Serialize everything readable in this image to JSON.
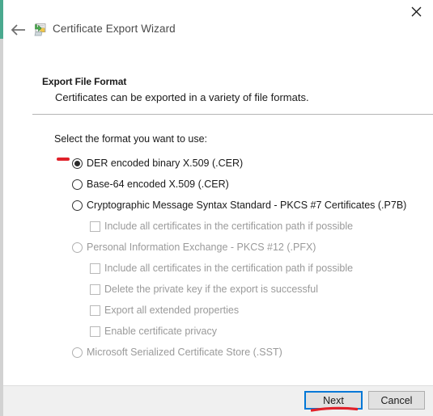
{
  "window": {
    "title": "Certificate Export Wizard",
    "back_icon": "back-arrow-icon",
    "close_icon": "close-icon",
    "app_icon": "certificate-export-icon",
    "accent_color": "#4aa98f"
  },
  "header": {
    "title": "Export File Format",
    "subtitle": "Certificates can be exported in a variety of file formats."
  },
  "body": {
    "prompt": "Select the format you want to use:",
    "options": [
      {
        "type": "radio",
        "label": "DER encoded binary X.509 (.CER)",
        "checked": true,
        "enabled": true,
        "indent": "radio"
      },
      {
        "type": "radio",
        "label": "Base-64 encoded X.509 (.CER)",
        "checked": false,
        "enabled": true,
        "indent": "radio"
      },
      {
        "type": "radio",
        "label": "Cryptographic Message Syntax Standard - PKCS #7 Certificates (.P7B)",
        "checked": false,
        "enabled": true,
        "indent": "radio"
      },
      {
        "type": "checkbox",
        "label": "Include all certificates in the certification path if possible",
        "checked": false,
        "enabled": false,
        "indent": "check"
      },
      {
        "type": "radio",
        "label": "Personal Information Exchange - PKCS #12 (.PFX)",
        "checked": false,
        "enabled": false,
        "indent": "radio"
      },
      {
        "type": "checkbox",
        "label": "Include all certificates in the certification path if possible",
        "checked": false,
        "enabled": false,
        "indent": "check"
      },
      {
        "type": "checkbox",
        "label": "Delete the private key if the export is successful",
        "checked": false,
        "enabled": false,
        "indent": "check"
      },
      {
        "type": "checkbox",
        "label": "Export all extended properties",
        "checked": false,
        "enabled": false,
        "indent": "check"
      },
      {
        "type": "checkbox",
        "label": "Enable certificate privacy",
        "checked": false,
        "enabled": false,
        "indent": "check"
      },
      {
        "type": "radio",
        "label": "Microsoft Serialized Certificate Store (.SST)",
        "checked": false,
        "enabled": false,
        "indent": "radio"
      }
    ]
  },
  "footer": {
    "next_label": "Next",
    "cancel_label": "Cancel",
    "focus_color": "#0078d7"
  },
  "annotations": {
    "dash_color": "#e0212a",
    "underline_color": "#e0212a"
  }
}
